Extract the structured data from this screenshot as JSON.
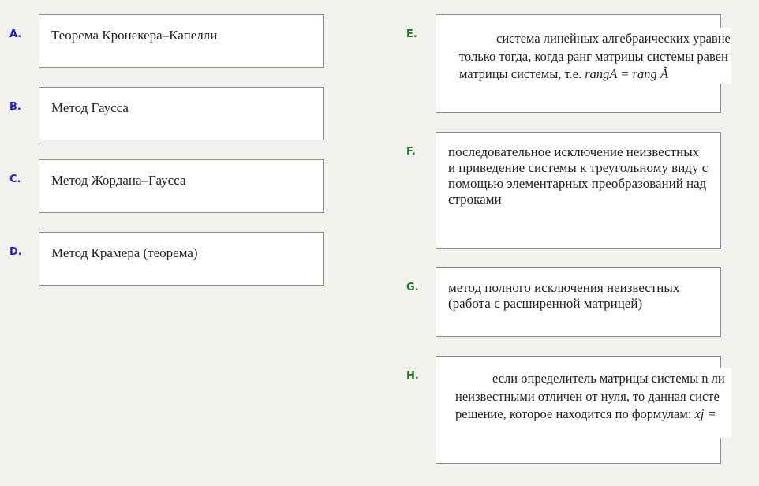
{
  "left": [
    {
      "letter": "A.",
      "text": "Теорема Кронекера–Капелли"
    },
    {
      "letter": "B.",
      "text": "Метод Гаусса"
    },
    {
      "letter": "C.",
      "text": "Метод Жордана–Гаусса"
    },
    {
      "letter": "D.",
      "text": "Метод Крамера (теорема)"
    }
  ],
  "right": [
    {
      "letter": "E.",
      "lines": [
        "система линейных алгебраических уравне",
        "только тогда, когда ранг матрицы системы равен",
        "матрицы системы, т.е. "
      ],
      "formula": "rangA  = rang Ã"
    },
    {
      "letter": "F.",
      "text": "последовательное исключение неизвестных и приведение системы к треугольному виду с помощью элементарных преобразований над строками"
    },
    {
      "letter": "G.",
      "text": "метод полного исключения неизвестных (работа с расширенной матрицей)"
    },
    {
      "letter": "H.",
      "lines": [
        "если определитель матрицы системы n ли",
        "неизвестными отличен от нуля, то данная систе",
        "решение, которое находится по формулам: "
      ],
      "formula": "xj = "
    }
  ]
}
